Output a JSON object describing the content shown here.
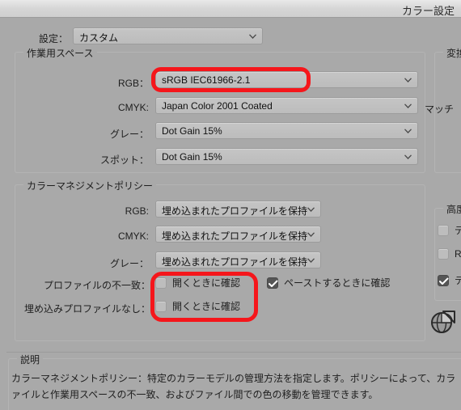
{
  "window": {
    "title": "カラー設定"
  },
  "settings_row": {
    "label": "設定：",
    "value": "カスタム"
  },
  "working_spaces": {
    "title": "作業用スペース",
    "rows": [
      {
        "label": "RGB：",
        "value": "sRGB IEC61966-2.1"
      },
      {
        "label": "CMYK:",
        "value": "Japan Color 2001 Coated"
      },
      {
        "label": "グレー：",
        "value": "Dot Gain 15%"
      },
      {
        "label": "スポット：",
        "value": "Dot Gain 15%"
      }
    ]
  },
  "policies": {
    "title": "カラーマネジメントポリシー",
    "rows": [
      {
        "label": "RGB:",
        "value": "埋め込まれたプロファイルを保持"
      },
      {
        "label": "CMYK:",
        "value": "埋め込まれたプロファイルを保持"
      },
      {
        "label": "グレー：",
        "value": "埋め込まれたプロファイルを保持"
      }
    ],
    "mismatch_label": "プロファイルの不一致：",
    "mismatch_open_label": "開くときに確認",
    "mismatch_open_checked": false,
    "mismatch_paste_label": "ペーストするときに確認",
    "mismatch_paste_checked": true,
    "missing_label": "埋め込みプロファイルなし：",
    "missing_open_label": "開くときに確認",
    "missing_open_checked": false
  },
  "right_panel": {
    "conversion_title": "変換",
    "matching_label": "マッチ",
    "advanced_title": "高度",
    "advanced_rows": [
      {
        "label": "デ",
        "checked": false
      },
      {
        "label": "R",
        "checked": false
      },
      {
        "label": "テ",
        "checked": true
      }
    ]
  },
  "description": {
    "title": "説明",
    "line1": "カラーマネジメントポリシー：特定のカラーモデルの管理方法を指定します。ポリシーによって、カラ",
    "line2": "ァイルと作業用スペースの不一致、およびファイル間での色の移動を管理できます。"
  },
  "colors": {
    "background": "#a9a9a9",
    "annotation_red": "#f5161b",
    "checkbox_checked": "#555555",
    "control_face": "#c0c0c0"
  },
  "icons": {
    "globe": "color-wheel-globe-icon",
    "chevron": "chevron-down-icon"
  }
}
